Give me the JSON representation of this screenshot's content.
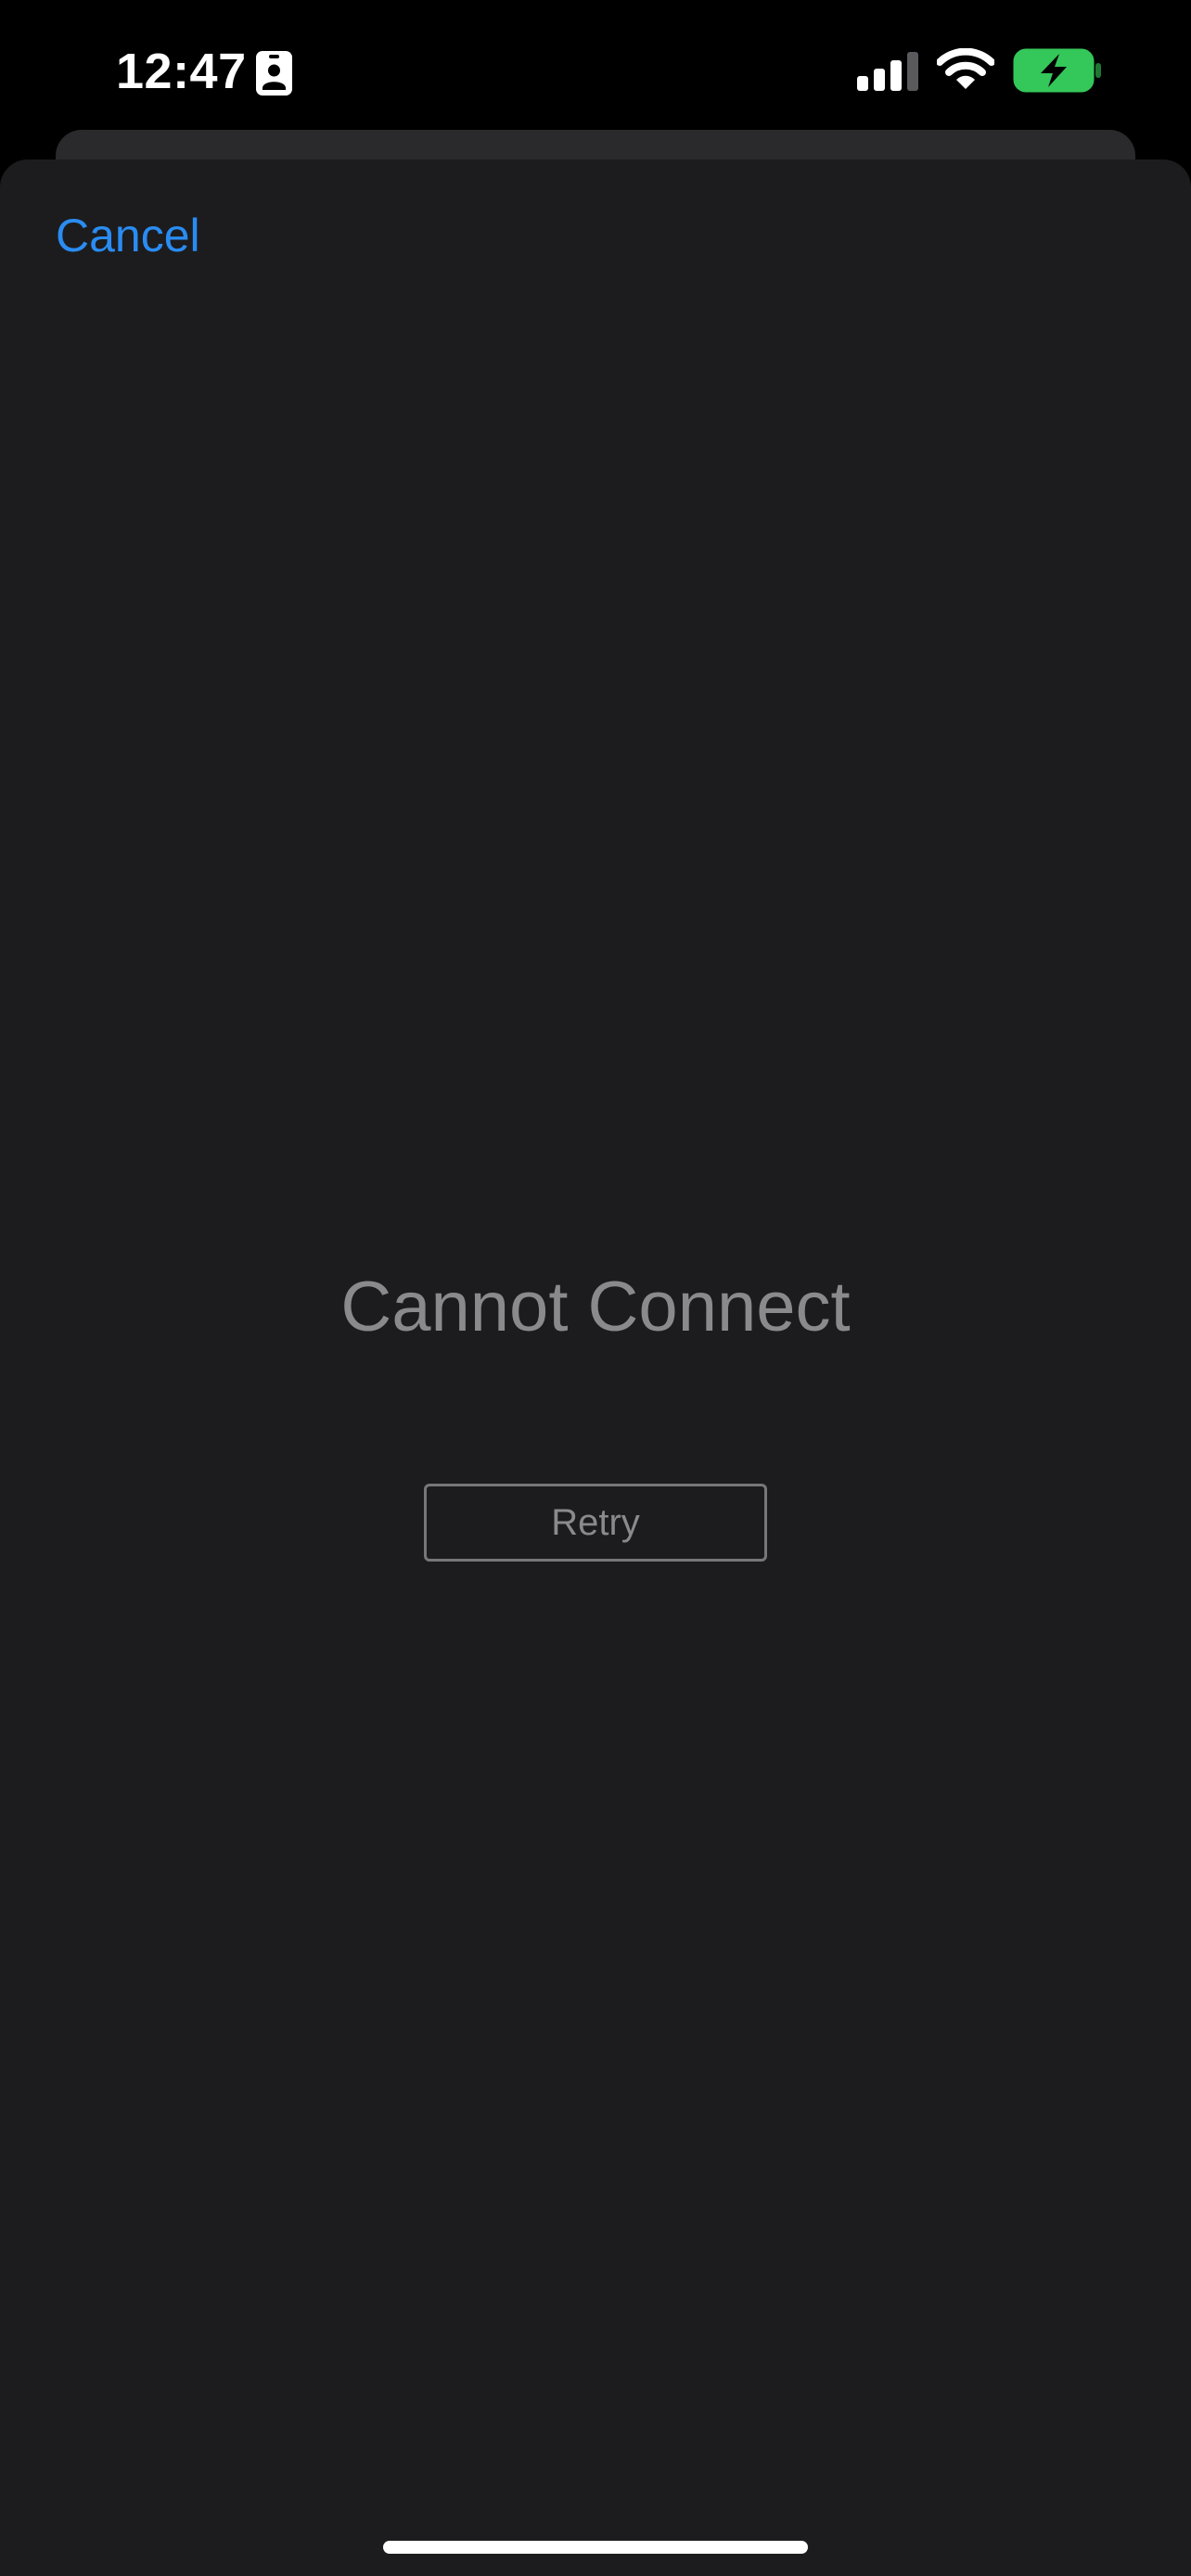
{
  "status_bar": {
    "time": "12:47",
    "icons": {
      "contact": "contact-card-icon",
      "signal": "cellular-signal-icon",
      "wifi": "wifi-icon",
      "battery": "battery-charging-icon"
    },
    "battery_color": "#34c759"
  },
  "sheet": {
    "cancel_label": "Cancel",
    "accent_color": "#2a8cf2"
  },
  "error": {
    "title": "Cannot Connect",
    "retry_label": "Retry"
  }
}
